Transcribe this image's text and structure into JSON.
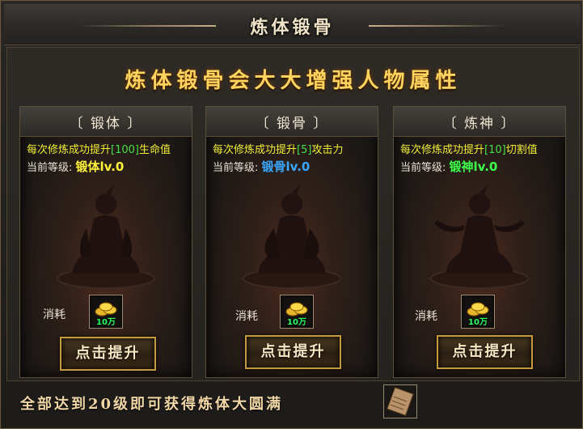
{
  "window": {
    "title": "炼体锻骨"
  },
  "headline": "炼体锻骨会大大增强人物属性",
  "cards": [
    {
      "title": "〔 锻体 〕",
      "desc_prefix": "每次修炼成功提升",
      "desc_value": "[100]",
      "desc_suffix": "生命值",
      "level_label": "当前等级:",
      "level_value": "锻体lv.0",
      "level_color": "#fff23a",
      "cost_label": "消耗",
      "cost_amount": "10万",
      "button": "点击提升"
    },
    {
      "title": "〔 锻骨 〕",
      "desc_prefix": "每次修炼成功提升",
      "desc_value": "[5]",
      "desc_suffix": "攻击力",
      "level_label": "当前等级:",
      "level_value": "锻骨lv.0",
      "level_color": "#3aa7ff",
      "cost_label": "消耗",
      "cost_amount": "10万",
      "button": "点击提升"
    },
    {
      "title": "〔 炼神 〕",
      "desc_prefix": "每次修炼成功提升",
      "desc_value": "[10]",
      "desc_suffix": "切割值",
      "level_label": "当前等级:",
      "level_value": "锻神lv.0",
      "level_color": "#3cff4a",
      "cost_label": "消耗",
      "cost_amount": "10万",
      "button": "点击提升"
    }
  ],
  "footer": {
    "text": "全部达到20级即可获得炼体大圆满"
  },
  "icons": {
    "coin": "gold-coins-icon",
    "reward": "scroll-reward-icon"
  }
}
